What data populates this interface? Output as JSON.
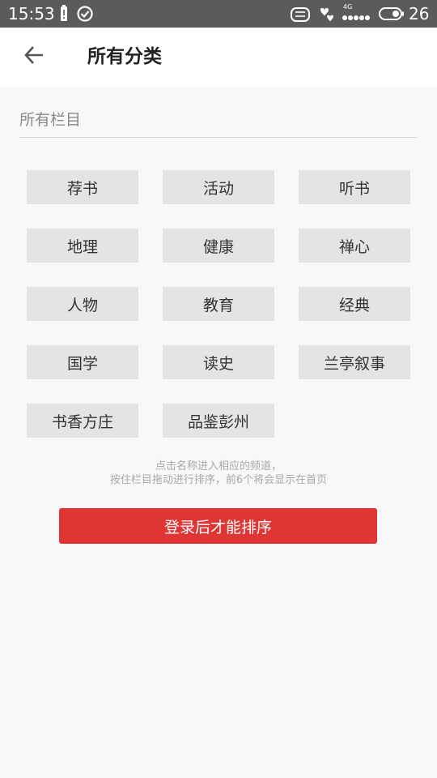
{
  "status_bar": {
    "time": "15:53",
    "network_label": "4G",
    "battery_level": "26",
    "icons": [
      "battery-alert-icon",
      "check-circle-icon",
      "notification-app-icon",
      "notification-app-icon",
      "signal-icon",
      "battery-icon"
    ]
  },
  "header": {
    "title": "所有分类",
    "back_icon": "arrow-left-icon"
  },
  "section": {
    "label": "所有栏目"
  },
  "categories": [
    "荐书",
    "活动",
    "听书",
    "地理",
    "健康",
    "禅心",
    "人物",
    "教育",
    "经典",
    "国学",
    "读史",
    "兰亭叙事",
    "书香方庄",
    "品鉴彭州"
  ],
  "hint": {
    "line1": "点击名称进入相应的频道，",
    "line2": "按住栏目拖动进行排序，前6个将会显示在首页"
  },
  "login_button": {
    "label": "登录后才能排序"
  },
  "colors": {
    "status_bar": "#5b5b5b",
    "accent": "#e03535",
    "chip_bg": "#e4e4e4",
    "page_bg": "#f8f8f8"
  }
}
